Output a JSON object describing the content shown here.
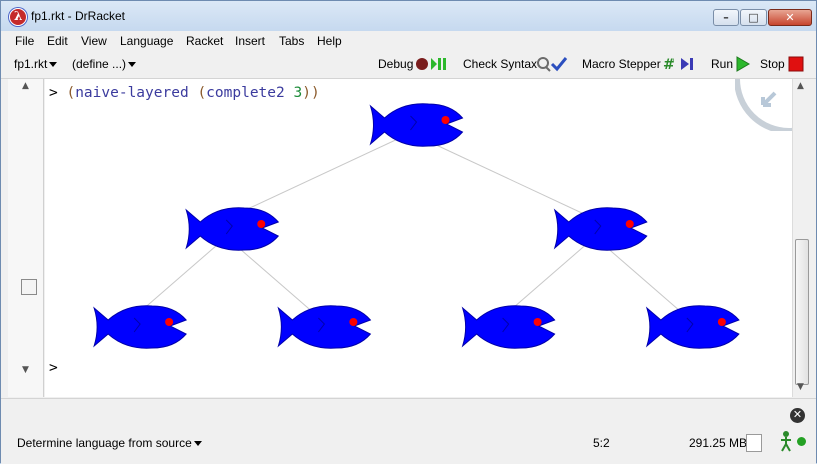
{
  "window": {
    "title": "fp1.rkt - DrRacket",
    "app_icon_glyph": "λ"
  },
  "window_controls": {
    "minimize": "–",
    "maximize": "□",
    "close": "✕"
  },
  "menubar": {
    "file": "File",
    "edit": "Edit",
    "view": "View",
    "language": "Language",
    "racket": "Racket",
    "insert": "Insert",
    "tabs": "Tabs",
    "help": "Help"
  },
  "toolbar": {
    "file_selector": "fp1.rkt",
    "define_selector": "(define ...)",
    "debug": "Debug",
    "check_syntax": "Check Syntax",
    "macro_stepper": "Macro Stepper",
    "run": "Run",
    "stop": "Stop"
  },
  "repl": {
    "prompt": ">",
    "fn": "naive-layered",
    "arg_fn": "complete2",
    "arg_num": "3",
    "next_prompt": ">"
  },
  "tree": {
    "fish_color": "#0000ff",
    "eye_color": "#ff0000",
    "edge_color": "#c8c8c8",
    "levels": [
      1,
      2,
      4
    ]
  },
  "status": {
    "language": "Determine language from source",
    "position": "5:2",
    "memory": "291.25 MB"
  },
  "colors": {
    "run_green": "#2cb82c",
    "stop_red": "#e01010",
    "accent": "#3b3b9e"
  }
}
